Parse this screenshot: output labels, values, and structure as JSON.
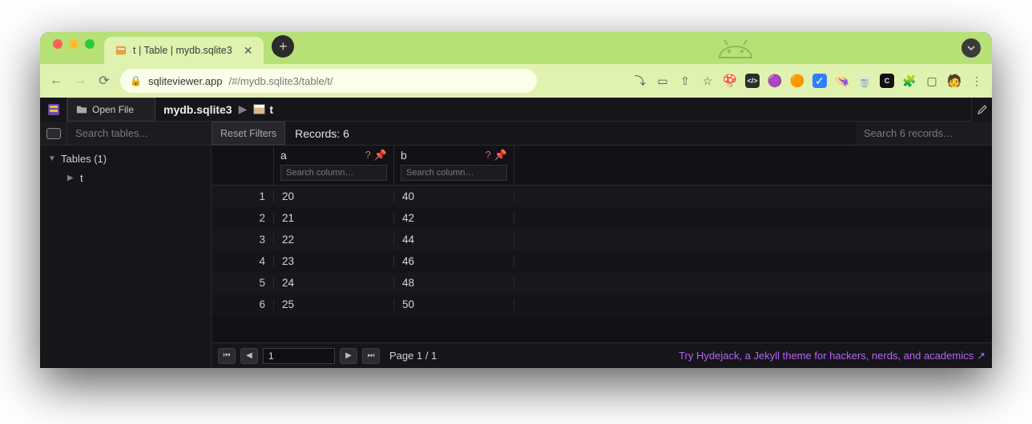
{
  "browser": {
    "tab_title": "t | Table | mydb.sqlite3",
    "url_host": "sqliteviewer.app",
    "url_path": "/#/mydb.sqlite3/table/t/"
  },
  "topbar": {
    "open_file": "Open File",
    "breadcrumb_db": "mydb.sqlite3",
    "breadcrumb_table": "t"
  },
  "toolbar": {
    "search_tables_placeholder": "Search tables...",
    "reset_filters": "Reset Filters",
    "records_label": "Records: 6",
    "search_records_placeholder": "Search 6 records…"
  },
  "sidebar": {
    "tables_header": "Tables (1)",
    "table_name": "t"
  },
  "grid": {
    "columns": [
      "a",
      "b"
    ],
    "column_search_placeholder": "Search column…",
    "rows": [
      {
        "n": "1",
        "a": "20",
        "b": "40"
      },
      {
        "n": "2",
        "a": "21",
        "b": "42"
      },
      {
        "n": "3",
        "a": "22",
        "b": "44"
      },
      {
        "n": "4",
        "a": "23",
        "b": "46"
      },
      {
        "n": "5",
        "a": "24",
        "b": "48"
      },
      {
        "n": "6",
        "a": "25",
        "b": "50"
      }
    ]
  },
  "pager": {
    "current": "1",
    "label": "Page 1 / 1",
    "try_link": "Try Hydejack, a Jekyll theme for hackers, nerds, and academics"
  }
}
